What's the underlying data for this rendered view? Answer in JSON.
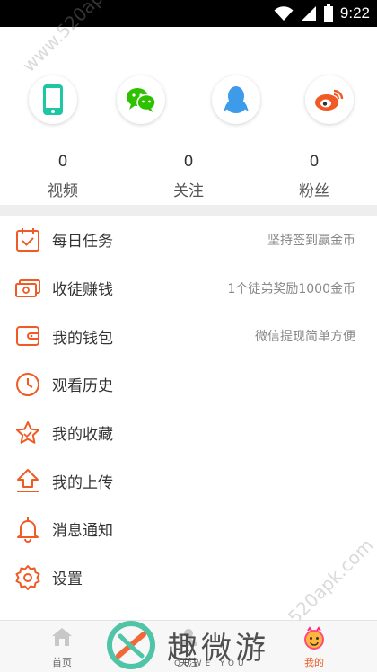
{
  "status_bar": {
    "time": "9:22"
  },
  "login_methods": [
    {
      "name": "phone",
      "icon": "phone-icon",
      "color": "#1ec6a4"
    },
    {
      "name": "wechat",
      "icon": "wechat-icon",
      "color": "#2dc100"
    },
    {
      "name": "qq",
      "icon": "qq-icon",
      "color": "#3d9be9"
    },
    {
      "name": "weibo",
      "icon": "weibo-icon",
      "color": "#f15a24"
    }
  ],
  "stats": [
    {
      "value": "0",
      "label": "视频"
    },
    {
      "value": "0",
      "label": "关注"
    },
    {
      "value": "0",
      "label": "粉丝"
    }
  ],
  "menu": [
    {
      "label": "每日任务",
      "desc": "坚持签到赢金币",
      "icon": "calendar-check-icon"
    },
    {
      "label": "收徒赚钱",
      "desc": "1个徒弟奖励1000金币",
      "icon": "cash-icon"
    },
    {
      "label": "我的钱包",
      "desc": "微信提现简单方便",
      "icon": "wallet-icon"
    },
    {
      "label": "观看历史",
      "desc": "",
      "icon": "clock-icon"
    },
    {
      "label": "我的收藏",
      "desc": "",
      "icon": "star-icon"
    },
    {
      "label": "我的上传",
      "desc": "",
      "icon": "upload-icon"
    },
    {
      "label": "消息通知",
      "desc": "",
      "icon": "bell-icon"
    },
    {
      "label": "设置",
      "desc": "",
      "icon": "gear-icon"
    }
  ],
  "tabs": [
    {
      "label": "首页",
      "icon": "home-icon",
      "active": false
    },
    {
      "label": "关注",
      "icon": "follow-icon",
      "active": false
    },
    {
      "label": "我的",
      "icon": "profile-face-icon",
      "active": true
    }
  ],
  "watermark": {
    "text": "www.520apk.com",
    "brand": "趣微游",
    "brand_sub": "QUWEIYOU"
  },
  "colors": {
    "accent": "#f15a24",
    "divider": "#eeeeee",
    "text": "#333333",
    "subtext": "#888888"
  }
}
